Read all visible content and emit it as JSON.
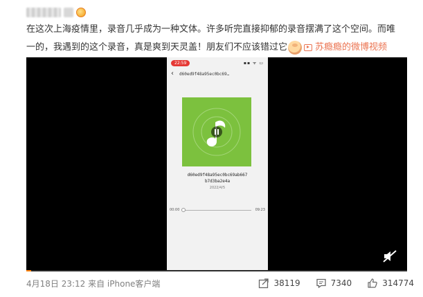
{
  "post": {
    "text_line1": "在这次上海疫情里，录音几乎成为一种文体。许多听完直接抑郁的录音摆满了这个空间。而唯",
    "text_line2": "一的，我遇到的这个录音，真是爽到天灵盖！朋友们不应该错过它",
    "link_label": "苏瘾瘾的微博视频"
  },
  "video": {
    "status_time": "22:59",
    "status_right": "▪▪ ᯤ ▭",
    "nav_title": "d60ed9f48a95ec0bc69…",
    "file_name_line1": "d60ed9f48a95ec0bc69ab667",
    "file_name_line2": "b7d3ba2e4a",
    "file_date": "2022/4/5",
    "time_current": "00:00",
    "time_total": "09:23",
    "progress_fraction": 0.0
  },
  "footer": {
    "meta": "4月18日 23:12 来自 iPhone客户端",
    "share_count": "38119",
    "comment_count": "7340",
    "like_count": "314774"
  },
  "colors": {
    "accent": "#eb7350",
    "cover_green": "#7cc13e",
    "video_progress": "#ff8200"
  }
}
